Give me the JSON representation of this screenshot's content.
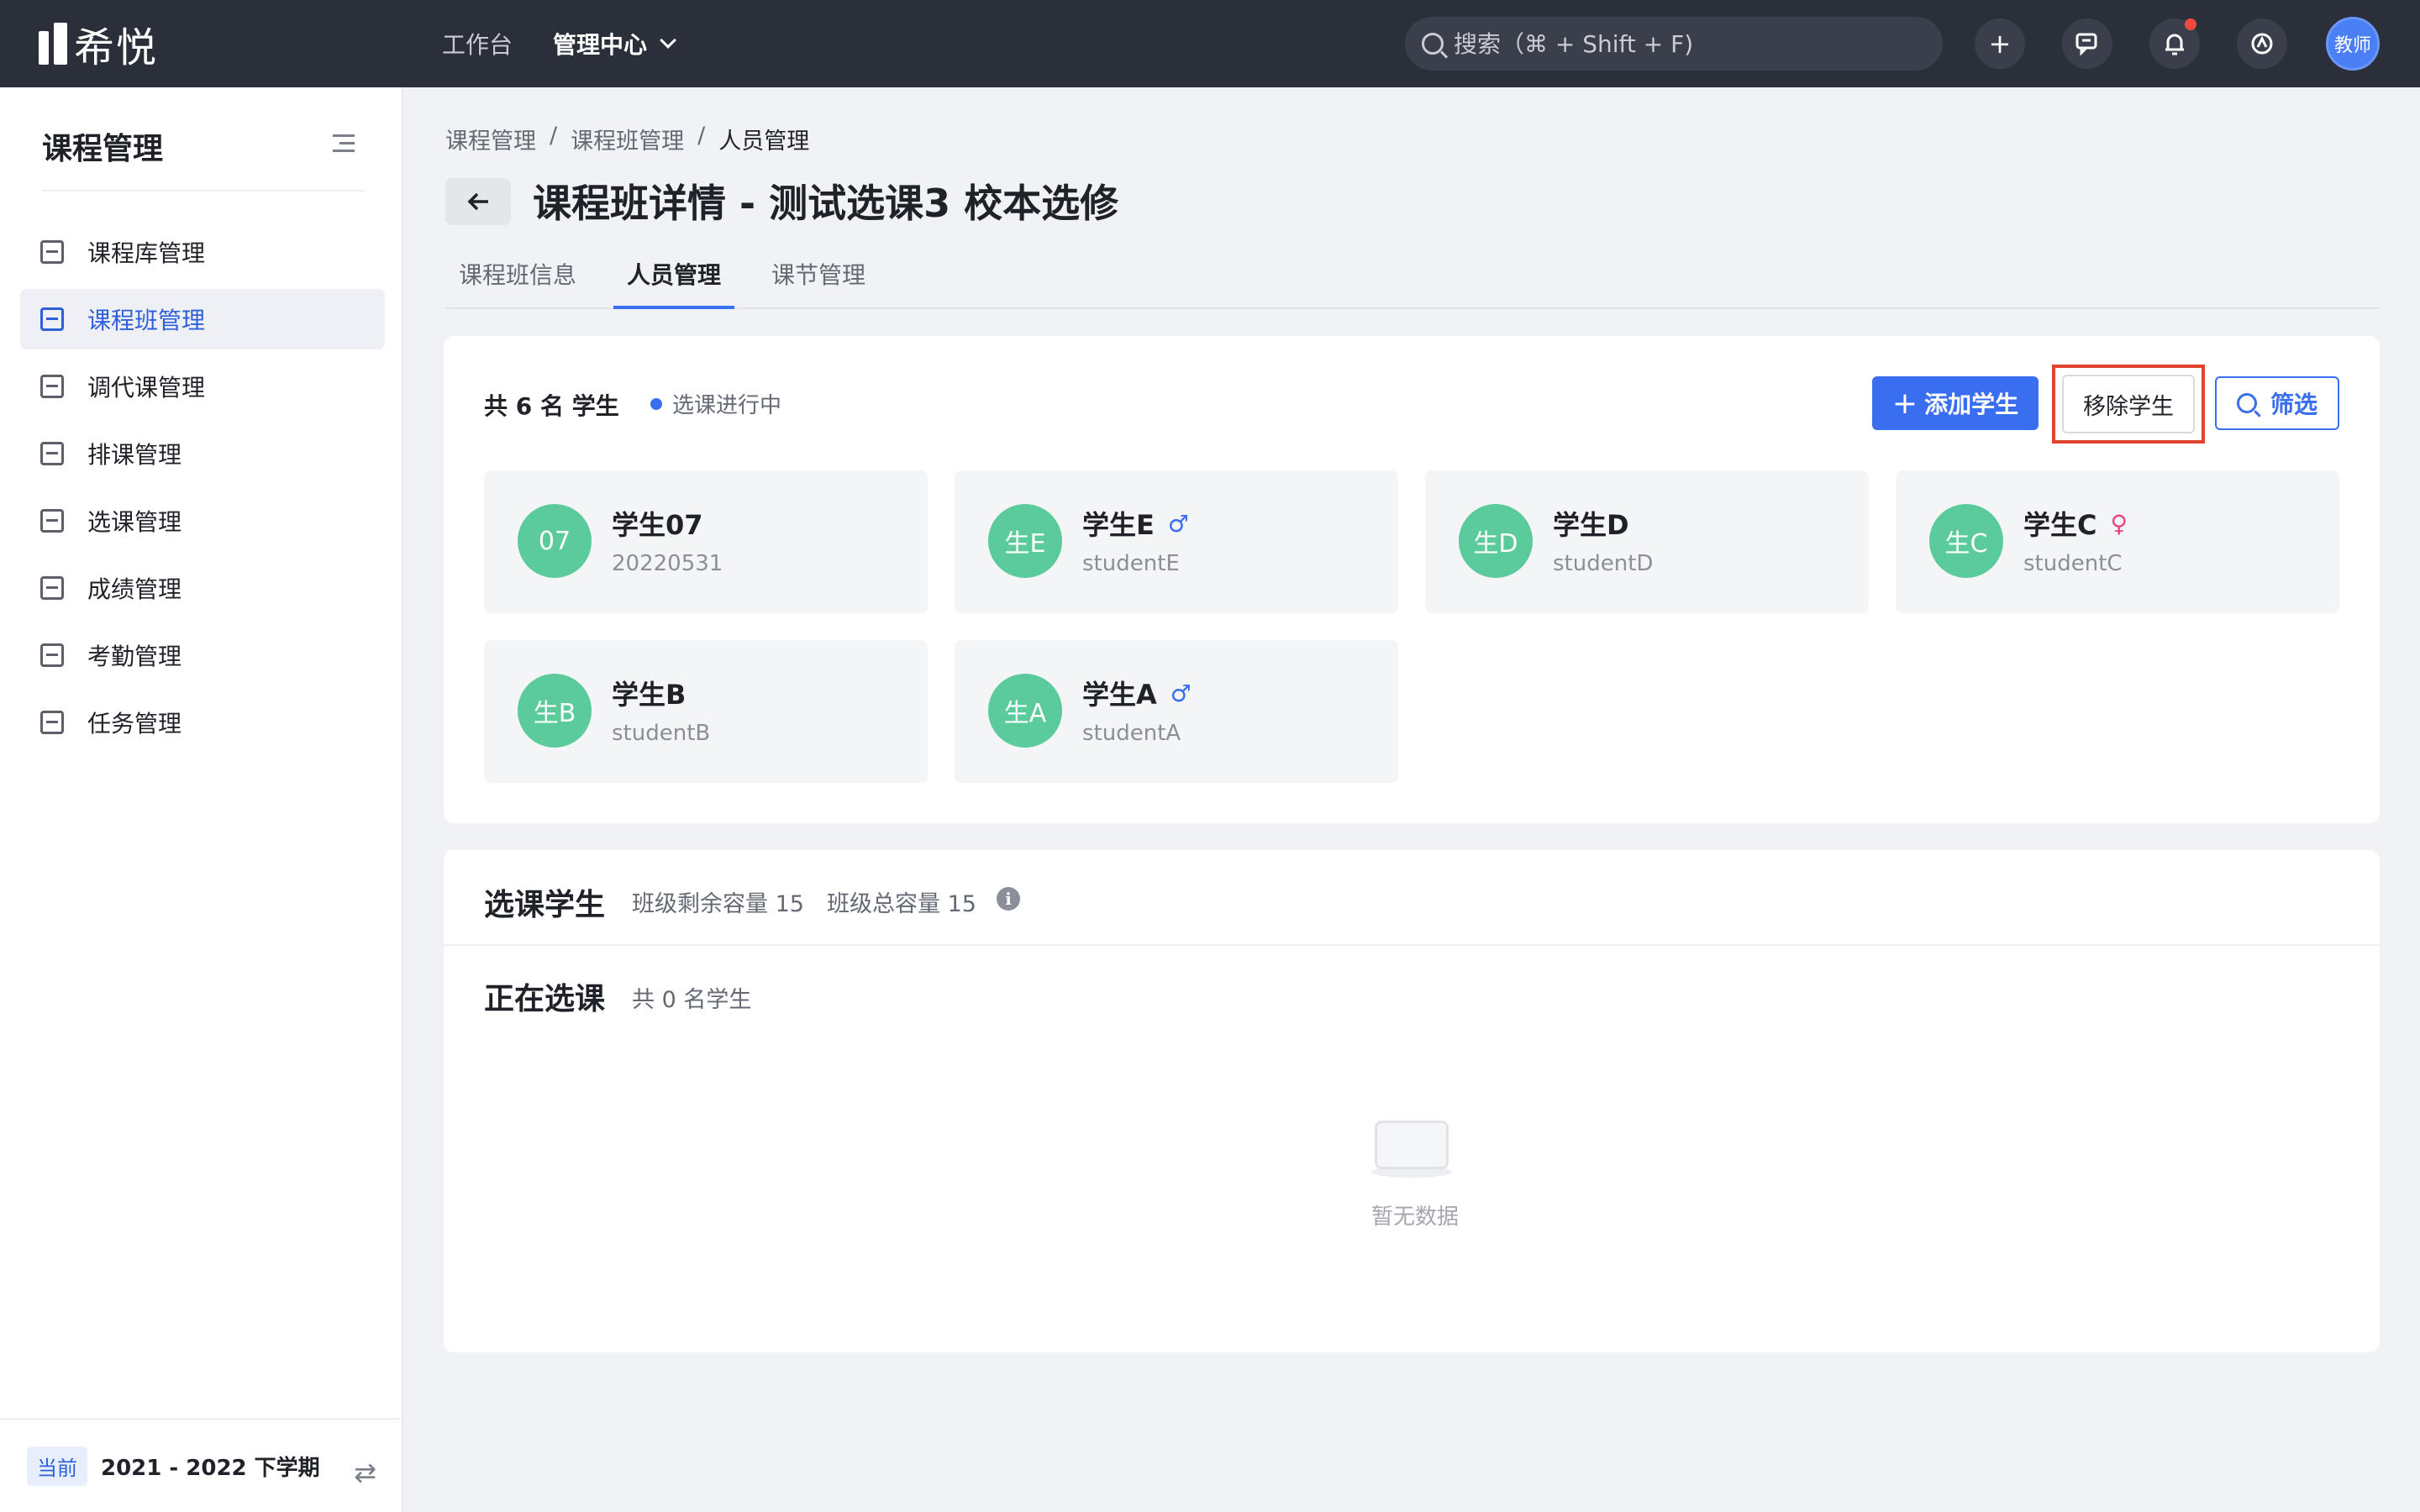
{
  "app": {
    "name": "希悦"
  },
  "topnav": {
    "items": [
      {
        "label": "工作台"
      },
      {
        "label": "管理中心"
      }
    ],
    "search_placeholder": "搜索（⌘ + Shift + F)",
    "user_label": "教师",
    "icons": [
      "plus-icon",
      "message-icon",
      "bell-icon",
      "sync-icon"
    ]
  },
  "sidebar": {
    "title": "课程管理",
    "items": [
      {
        "label": "课程库管理",
        "icon": "course-library-icon"
      },
      {
        "label": "课程班管理",
        "icon": "class-icon"
      },
      {
        "label": "调代课管理",
        "icon": "substitute-icon"
      },
      {
        "label": "排课管理",
        "icon": "schedule-icon"
      },
      {
        "label": "选课管理",
        "icon": "selection-icon"
      },
      {
        "label": "成绩管理",
        "icon": "grades-icon"
      },
      {
        "label": "考勤管理",
        "icon": "attendance-icon"
      },
      {
        "label": "任务管理",
        "icon": "tasks-icon"
      }
    ],
    "active_index": 1,
    "footer": {
      "tag": "当前",
      "term": "2021 - 2022 下学期"
    }
  },
  "breadcrumb": [
    "课程管理",
    "课程班管理",
    "人员管理"
  ],
  "page_title": "课程班详情 - 测试选课3 校本选修",
  "tabs": [
    {
      "label": "课程班信息"
    },
    {
      "label": "人员管理"
    },
    {
      "label": "课节管理"
    }
  ],
  "active_tab": 1,
  "students_card": {
    "count_text": "共 6 名 学生",
    "status": "选课进行中",
    "add_button": "添加学生",
    "remove_button": "移除学生",
    "filter_button": "筛选",
    "students": [
      {
        "avatar": "07",
        "name": "学生07",
        "id": "20220531",
        "gender": ""
      },
      {
        "avatar": "生E",
        "name": "学生E",
        "id": "studentE",
        "gender": "♂"
      },
      {
        "avatar": "生D",
        "name": "学生D",
        "id": "studentD",
        "gender": ""
      },
      {
        "avatar": "生C",
        "name": "学生C",
        "id": "studentC",
        "gender": "♀"
      },
      {
        "avatar": "生B",
        "name": "学生B",
        "id": "studentB",
        "gender": ""
      },
      {
        "avatar": "生A",
        "name": "学生A",
        "id": "studentA",
        "gender": "♂"
      }
    ]
  },
  "selection_card": {
    "title": "选课学生",
    "remaining_capacity": "班级剩余容量 15",
    "total_capacity": "班级总容量 15",
    "info_icon": "i",
    "in_progress_title": "正在选课",
    "in_progress_count": "共 0 名学生",
    "empty_text": "暂无数据"
  },
  "colors": {
    "accent": "#3a6ef0",
    "topbar": "#2b2f3a",
    "avatar": "#5ccb9c",
    "highlight_box": "#e0442f"
  }
}
